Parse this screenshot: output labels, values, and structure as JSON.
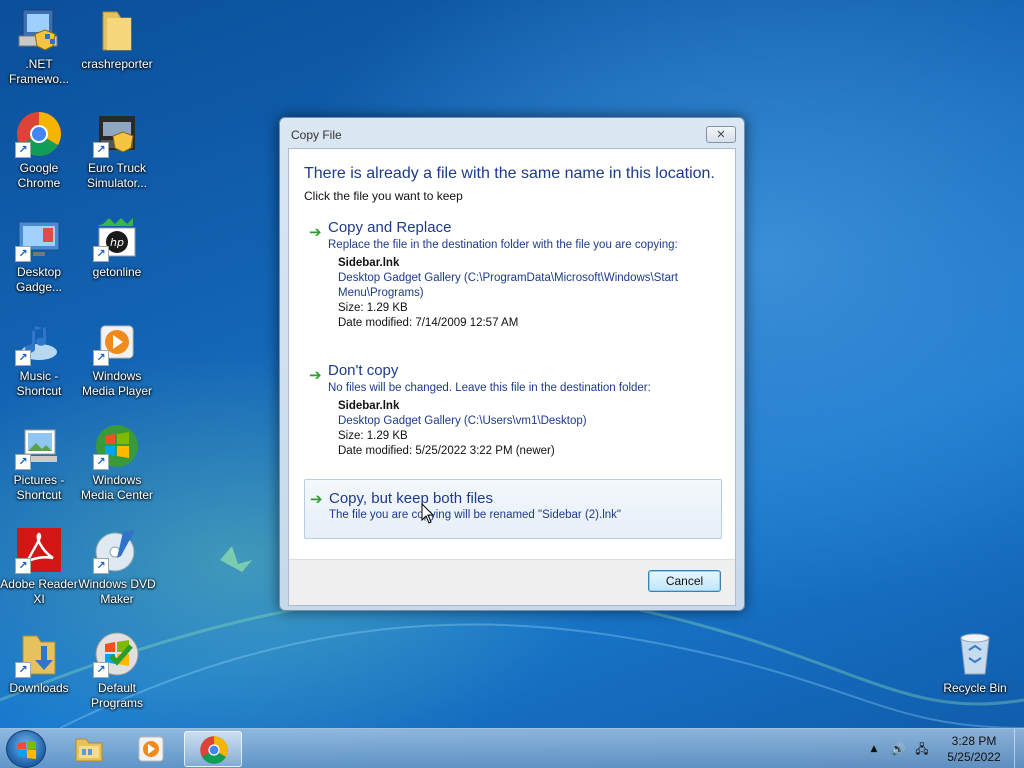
{
  "desktop": {
    "icons": [
      {
        "label": ".NET Framewo...",
        "icon": "dotnet-setup-icon"
      },
      {
        "label": "crashreporter",
        "icon": "folder-icon"
      },
      {
        "label": "Google Chrome",
        "icon": "chrome-icon"
      },
      {
        "label": "Euro Truck Simulator...",
        "icon": "truck-game-icon"
      },
      {
        "label": "Desktop Gadge...",
        "icon": "desktop-gadgets-icon"
      },
      {
        "label": "getonline",
        "icon": "hp-icon"
      },
      {
        "label": "Music - Shortcut",
        "icon": "music-icon"
      },
      {
        "label": "Windows Media Player",
        "icon": "media-player-icon"
      },
      {
        "label": "Pictures - Shortcut",
        "icon": "pictures-icon"
      },
      {
        "label": "Windows Media Center",
        "icon": "media-center-icon"
      },
      {
        "label": "Adobe Reader XI",
        "icon": "adobe-reader-icon"
      },
      {
        "label": "Windows DVD Maker",
        "icon": "dvd-maker-icon"
      },
      {
        "label": "Downloads",
        "icon": "downloads-folder-icon"
      },
      {
        "label": "Default Programs",
        "icon": "default-programs-icon"
      },
      {
        "label": "Recycle Bin",
        "icon": "recycle-bin-icon"
      }
    ]
  },
  "dialog": {
    "title": "Copy File",
    "close_glyph": "✕",
    "heading": "There is already a file with the same name in this location.",
    "subheading": "Click the file you want to keep",
    "options": [
      {
        "title": "Copy and Replace",
        "description": "Replace the file in the destination folder with the file you are copying:",
        "file_name": "Sidebar.lnk",
        "location_line1": "Desktop Gadget Gallery (C:\\ProgramData\\Microsoft\\Windows\\Start",
        "location_line2": "Menu\\Programs)",
        "size": "Size: 1.29 KB",
        "date_modified": "Date modified: 7/14/2009 12:57 AM"
      },
      {
        "title": "Don't copy",
        "description": "No files will be changed. Leave this file in the destination folder:",
        "file_name": "Sidebar.lnk",
        "location_line1": "Desktop Gadget Gallery (C:\\Users\\vm1\\Desktop)",
        "size": "Size: 1.29 KB",
        "date_modified": "Date modified: 5/25/2022 3:22 PM (newer)"
      },
      {
        "title": "Copy, but keep both files",
        "description": "The file you are copying will be renamed \"Sidebar (2).lnk\""
      }
    ],
    "arrow_glyph": "➔",
    "cancel_label": "Cancel"
  },
  "taskbar": {
    "items": [
      {
        "name": "windows-explorer",
        "icon": "explorer-folder-icon"
      },
      {
        "name": "windows-media-player",
        "icon": "media-player-icon"
      },
      {
        "name": "google-chrome",
        "icon": "chrome-icon",
        "active": true
      }
    ],
    "tray": {
      "show_hidden_glyph": "▲",
      "volume_glyph": "🔊",
      "network_glyph": "🖧"
    },
    "clock": {
      "time": "3:28 PM",
      "date": "5/25/2022"
    }
  }
}
